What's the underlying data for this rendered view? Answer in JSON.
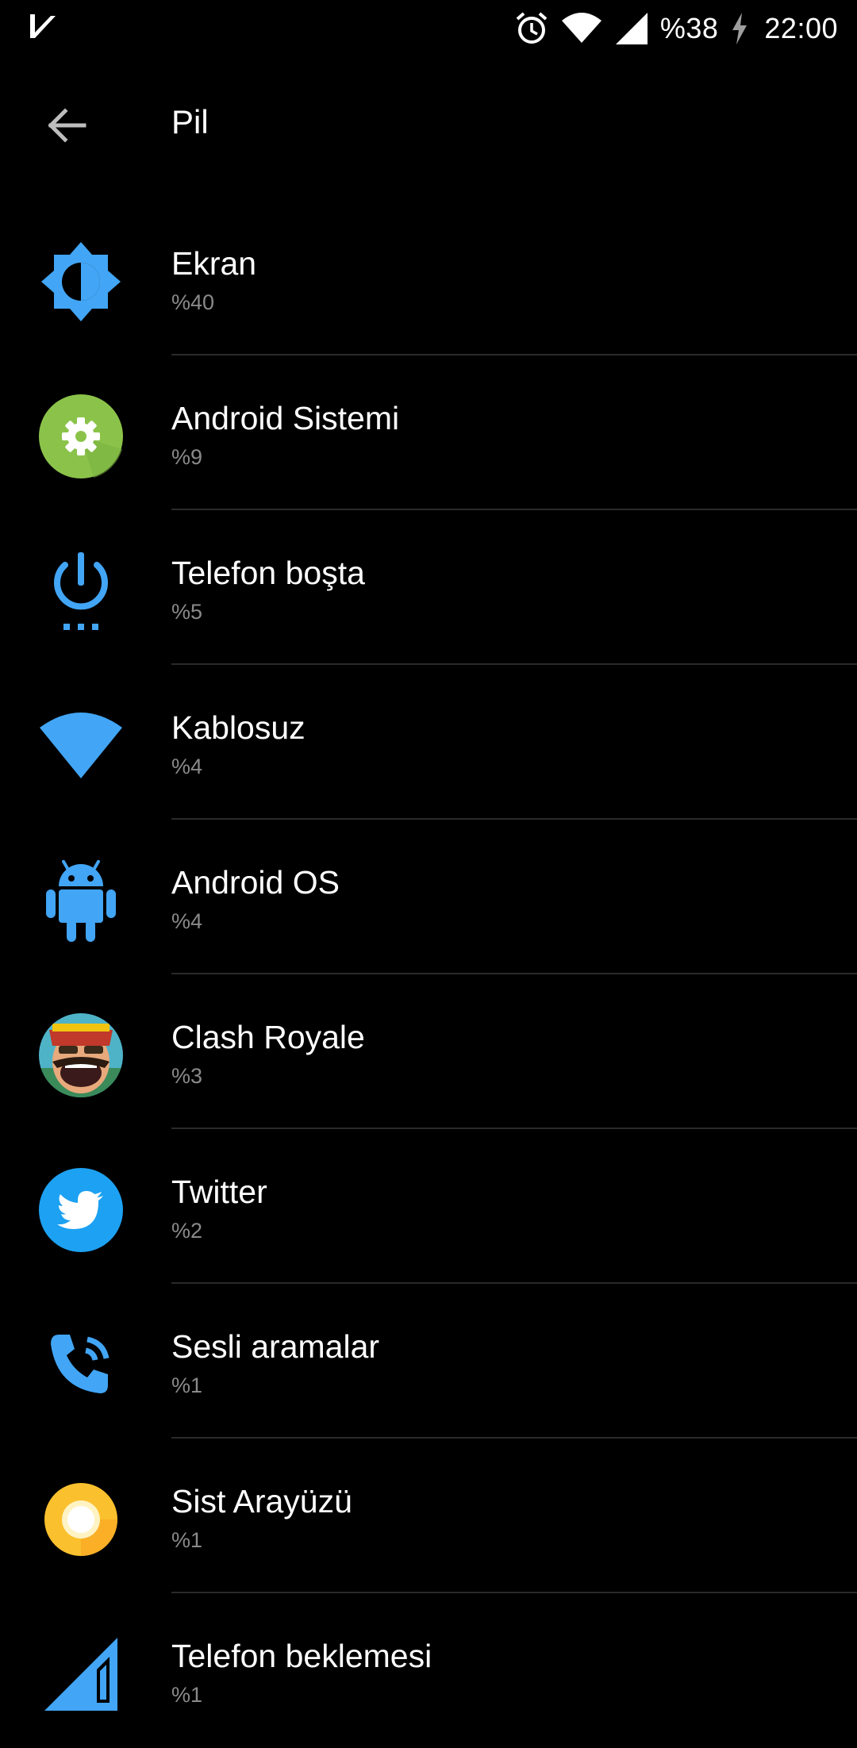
{
  "status_bar": {
    "battery_text": "%38",
    "time": "22:00",
    "left_icon": "check-badge-icon",
    "icons": [
      "alarm-icon",
      "wifi-icon",
      "signal-icon",
      "charging-icon"
    ]
  },
  "appbar": {
    "title": "Pil",
    "back_icon": "arrow-back-icon"
  },
  "colors": {
    "background": "#000000",
    "accent_blue": "#42a5f5",
    "secondary_text": "#8a8a8a",
    "android_green": "#8bc34a",
    "ui_yellow": "#fbc02d",
    "twitter_blue": "#1da1f2"
  },
  "items": [
    {
      "label": "Ekran",
      "value": "%40",
      "icon": "brightness-icon"
    },
    {
      "label": "Android Sistemi",
      "value": "%9",
      "icon": "settings-gear-icon"
    },
    {
      "label": "Telefon boşta",
      "value": "%5",
      "icon": "power-idle-icon"
    },
    {
      "label": "Kablosuz",
      "value": "%4",
      "icon": "wifi-icon"
    },
    {
      "label": "Android OS",
      "value": "%4",
      "icon": "android-robot-icon"
    },
    {
      "label": "Clash Royale",
      "value": "%3",
      "icon": "clash-royale-app-icon"
    },
    {
      "label": "Twitter",
      "value": "%2",
      "icon": "twitter-bird-icon"
    },
    {
      "label": "Sesli aramalar",
      "value": "%1",
      "icon": "phone-call-icon"
    },
    {
      "label": "Sist Arayüzü",
      "value": "%1",
      "icon": "system-ui-icon"
    },
    {
      "label": "Telefon beklemesi",
      "value": "%1",
      "icon": "cell-standby-icon"
    }
  ]
}
